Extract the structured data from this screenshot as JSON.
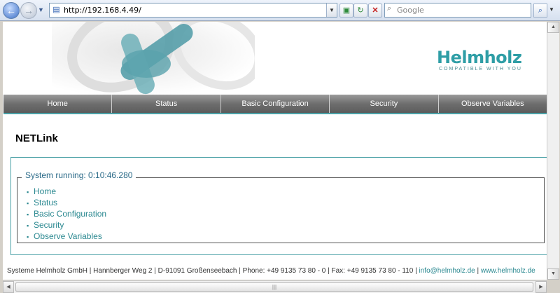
{
  "browser": {
    "url": "http://192.168.4.49/",
    "search_placeholder": "Google",
    "icons": {
      "back": "back-arrow-icon",
      "forward": "forward-arrow-icon",
      "compat": "compatibility-view-icon",
      "refresh": "refresh-icon",
      "stop": "stop-icon",
      "search": "search-icon"
    }
  },
  "brand": {
    "logo": "Helmholz",
    "tagline": "COMPATIBLE WITH YOU"
  },
  "nav": {
    "items": [
      "Home",
      "Status",
      "Basic Configuration",
      "Security",
      "Observe Variables"
    ]
  },
  "page": {
    "title": "NETLink",
    "status_label": "System running: 0:10:46.280",
    "links": [
      "Home",
      "Status",
      "Basic Configuration",
      "Security",
      "Observe Variables"
    ]
  },
  "footer": {
    "address": "Systeme Helmholz GmbH | Hannberger Weg 2 | D-91091 Großenseebach | Phone: +49 9135 73 80 - 0 | Fax: +49 9135 73 80 - 110 | ",
    "email": "info@helmholz.de",
    "separator": " | ",
    "website": "www.helmholz.de"
  },
  "colors": {
    "accent": "#4aa0a6",
    "nav_bg": "#6e6e6e",
    "link": "#2a8890"
  }
}
